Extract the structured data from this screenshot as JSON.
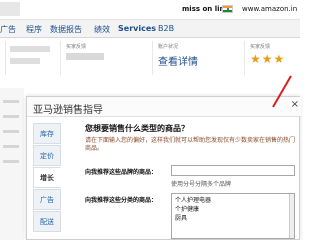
{
  "header": {
    "account_name": "miss on line",
    "site_url": "www.amazon.in"
  },
  "nav": {
    "items": [
      "广告",
      "程序",
      "数据报告",
      "绩效",
      "Services",
      "B2B"
    ]
  },
  "cards": {
    "c1_caption": "买家反馈",
    "c2_caption": "账户状况",
    "c2_value": "查看详情",
    "c3_caption": "买家反馈",
    "c3_stars": "★★★"
  },
  "modal": {
    "title": "亚马逊销售指导",
    "close": "×",
    "tabs": [
      "库存",
      "定价",
      "增长",
      "广告",
      "配送"
    ],
    "active_tab_index": 2,
    "question": "您想要销售什么类型的商品？",
    "description": "请在下面输入您的偏好，这样我们就可以帮助您发现仅有少数卖家在销售的热门商品。",
    "brand_label": "向我推荐这些品牌的商品：",
    "brand_hint": "使用分号分隔多个品牌",
    "category_label": "向我推荐这些分类的商品：",
    "categories": [
      "个人护理电器",
      "个护健康",
      "厨具"
    ]
  },
  "colors": {
    "link_blue": "#1b4e8e",
    "star_gold": "#e2a012",
    "arrow_red": "#d62020"
  }
}
